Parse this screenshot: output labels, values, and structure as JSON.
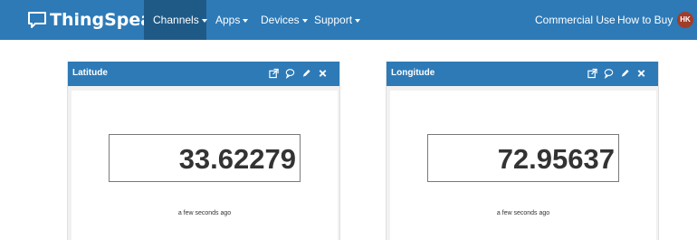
{
  "navbar": {
    "brand": "ThingSpeak",
    "brand_tm": "™",
    "menu": [
      {
        "label": "Channels"
      },
      {
        "label": "Apps"
      },
      {
        "label": "Devices"
      },
      {
        "label": "Support"
      }
    ],
    "right": [
      {
        "label": "Commercial Use"
      },
      {
        "label": "How to Buy"
      }
    ],
    "avatar_initials": "HK",
    "color": "#2d7ab7",
    "active_color": "#1f5a87"
  },
  "widgets": [
    {
      "title": "Latitude",
      "value": "33.62279",
      "updated": "a few seconds ago",
      "tools": [
        "external-link-icon",
        "comment-icon",
        "pencil-icon",
        "close-icon"
      ]
    },
    {
      "title": "Longitude",
      "value": "72.95637",
      "updated": "a few seconds ago",
      "tools": [
        "external-link-icon",
        "comment-icon",
        "pencil-icon",
        "close-icon"
      ]
    }
  ]
}
